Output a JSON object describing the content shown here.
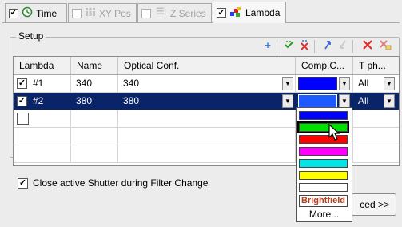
{
  "tabs": [
    {
      "label": "Time",
      "checked": true,
      "enabled": true
    },
    {
      "label": "XY Pos",
      "checked": false,
      "enabled": false
    },
    {
      "label": "Z Series",
      "checked": false,
      "enabled": false
    },
    {
      "label": "Lambda",
      "checked": true,
      "enabled": true
    }
  ],
  "setup": {
    "legend": "Setup"
  },
  "toolbar": {
    "icons": [
      "add-icon",
      "check-all-icon",
      "uncheck-all-icon",
      "move-up-icon",
      "move-down-icon",
      "delete-icon",
      "delete-all-icon"
    ]
  },
  "table": {
    "headers": [
      "Lambda",
      "Name",
      "Optical Conf.",
      "Comp.C...",
      "T ph..."
    ],
    "rows": [
      {
        "checked": true,
        "lambda": "#1",
        "name": "340",
        "optical": "340",
        "color": "#0000ff",
        "tph": "All"
      },
      {
        "checked": true,
        "lambda": "#2",
        "name": "380",
        "optical": "380",
        "color": "#1e5aff",
        "tph": "All"
      }
    ],
    "empty_checkbox": true
  },
  "color_dropdown": {
    "options": [
      "#0000ff",
      "#00e000",
      "#ff0000",
      "#ff00ff",
      "#00e5e5",
      "#ffff00",
      "#ffffff"
    ],
    "special_label": "Brightfield",
    "more_label": "More..."
  },
  "options": {
    "close_shutter_label": "Close active Shutter during Filter Change",
    "close_shutter_checked": true
  },
  "buttons": {
    "advanced_label": "ced >>"
  }
}
